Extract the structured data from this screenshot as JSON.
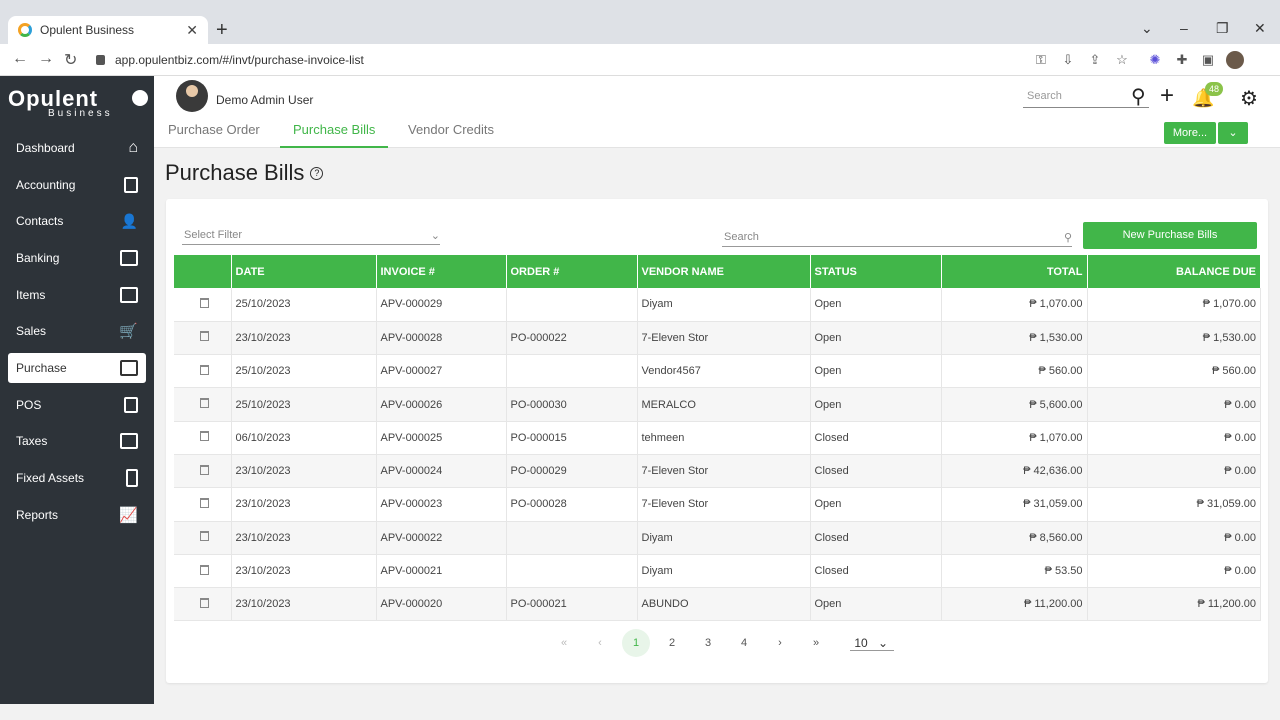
{
  "browser": {
    "tab_title": "Opulent Business",
    "url": "app.opulentbiz.com/#/invt/purchase-invoice-list"
  },
  "logo": {
    "main": "Opulent",
    "sub": "Business"
  },
  "sidebar": {
    "items": [
      {
        "label": "Dashboard",
        "icon": "home-icon"
      },
      {
        "label": "Accounting",
        "icon": "ledger-icon"
      },
      {
        "label": "Contacts",
        "icon": "add-person-icon"
      },
      {
        "label": "Banking",
        "icon": "briefcase-icon"
      },
      {
        "label": "Items",
        "icon": "bag-icon"
      },
      {
        "label": "Sales",
        "icon": "cart-icon"
      },
      {
        "label": "Purchase",
        "icon": "credit-card-icon"
      },
      {
        "label": "POS",
        "icon": "document-icon"
      },
      {
        "label": "Taxes",
        "icon": "wallet-icon"
      },
      {
        "label": "Fixed Assets",
        "icon": "building-icon"
      },
      {
        "label": "Reports",
        "icon": "chart-icon"
      }
    ],
    "active": "Purchase"
  },
  "header": {
    "user_name": "Demo Admin User",
    "search_placeholder": "Search",
    "notification_count": "48",
    "tabs": [
      "Purchase Order",
      "Purchase Bills",
      "Vendor Credits"
    ],
    "active_tab": "Purchase Bills",
    "more_label": "More..."
  },
  "page": {
    "title": "Purchase Bills",
    "filter_placeholder": "Select Filter",
    "search_placeholder": "Search",
    "new_button": "New Purchase Bills"
  },
  "table": {
    "columns": [
      "DATE",
      "INVOICE #",
      "ORDER #",
      "VENDOR NAME",
      "STATUS",
      "TOTAL",
      "BALANCE DUE"
    ],
    "rows": [
      [
        "25/10/2023",
        "APV-000029",
        "",
        "Diyam",
        "Open",
        "₱ 1,070.00",
        "₱ 1,070.00"
      ],
      [
        "23/10/2023",
        "APV-000028",
        "PO-000022",
        "7-Eleven Stor",
        "Open",
        "₱ 1,530.00",
        "₱ 1,530.00"
      ],
      [
        "25/10/2023",
        "APV-000027",
        "",
        "Vendor4567",
        "Open",
        "₱ 560.00",
        "₱ 560.00"
      ],
      [
        "25/10/2023",
        "APV-000026",
        "PO-000030",
        "MERALCO",
        "Open",
        "₱ 5,600.00",
        "₱ 0.00"
      ],
      [
        "06/10/2023",
        "APV-000025",
        "PO-000015",
        "tehmeen",
        "Closed",
        "₱ 1,070.00",
        "₱ 0.00"
      ],
      [
        "23/10/2023",
        "APV-000024",
        "PO-000029",
        "7-Eleven Stor",
        "Closed",
        "₱ 42,636.00",
        "₱ 0.00"
      ],
      [
        "23/10/2023",
        "APV-000023",
        "PO-000028",
        "7-Eleven Stor",
        "Open",
        "₱ 31,059.00",
        "₱ 31,059.00"
      ],
      [
        "23/10/2023",
        "APV-000022",
        "",
        "Diyam",
        "Closed",
        "₱ 8,560.00",
        "₱ 0.00"
      ],
      [
        "23/10/2023",
        "APV-000021",
        "",
        "Diyam",
        "Closed",
        "₱ 53.50",
        "₱ 0.00"
      ],
      [
        "23/10/2023",
        "APV-000020",
        "PO-000021",
        "ABUNDO",
        "Open",
        "₱ 11,200.00",
        "₱ 11,200.00"
      ]
    ]
  },
  "pagination": {
    "first": "«",
    "prev": "‹",
    "pages": [
      "1",
      "2",
      "3",
      "4"
    ],
    "current": "1",
    "next": "›",
    "last": "»",
    "page_size": "10"
  },
  "colors": {
    "accent": "#41b649",
    "sidebar": "#2d3339"
  }
}
